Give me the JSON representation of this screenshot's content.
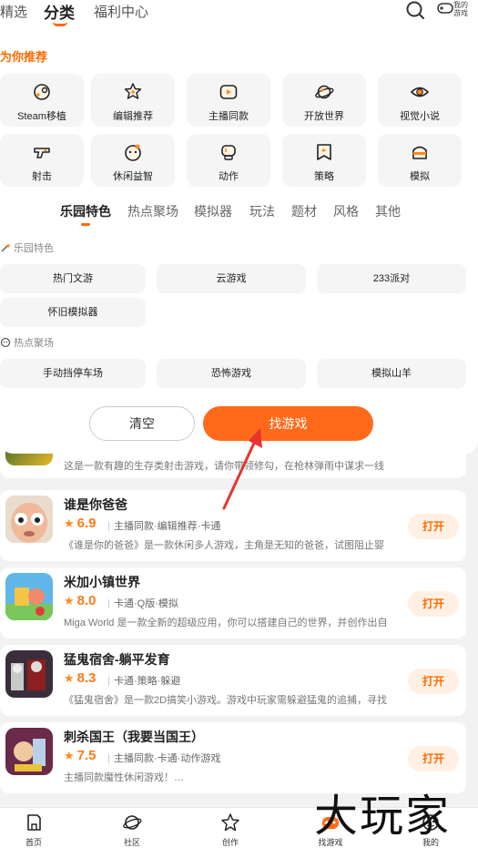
{
  "top_nav": {
    "featured": "精选",
    "category": "分类",
    "welfare": "福利中心",
    "my_games": "我的游戏"
  },
  "recommend": {
    "title": "为你推荐",
    "categories": [
      {
        "label": "Steam移植",
        "icon": "gamepad-icon"
      },
      {
        "label": "编辑推荐",
        "icon": "star-badge-icon"
      },
      {
        "label": "主播同款",
        "icon": "play-video-icon"
      },
      {
        "label": "开放世界",
        "icon": "planet-icon"
      },
      {
        "label": "视觉小说",
        "icon": "eye-icon"
      },
      {
        "label": "射击",
        "icon": "gun-icon"
      },
      {
        "label": "休闲益智",
        "icon": "puzzle-face-icon"
      },
      {
        "label": "动作",
        "icon": "fist-icon"
      },
      {
        "label": "策略",
        "icon": "flag-icon"
      },
      {
        "label": "模拟",
        "icon": "cake-icon"
      }
    ]
  },
  "tabs": [
    "乐园特色",
    "热点聚场",
    "模拟器",
    "玩法",
    "题材",
    "风格",
    "其他"
  ],
  "sections": [
    {
      "title": "乐园特色",
      "chips": [
        "热门文游",
        "云游戏",
        "233派对",
        "怀旧模拟器"
      ]
    },
    {
      "title": "热点聚场",
      "chips": [
        "手动挡停车场",
        "恐怖游戏",
        "模拟山羊"
      ]
    }
  ],
  "actions": {
    "clear": "清空",
    "find": "找游戏"
  },
  "games": [
    {
      "name": "",
      "score": "",
      "tags": "",
      "desc": "这是一款有趣的生存类射击游戏，请你带领修勾，在枪林弹雨中谋求一线",
      "open": ""
    },
    {
      "name": "谁是你爸爸",
      "score": "6.9",
      "tags": "主播同款·编辑推荐·卡通",
      "desc": "《谁是你的爸爸》是一款休闲多人游戏，主角是无知的爸爸，试图阻止婴",
      "open": "打开"
    },
    {
      "name": "米加小镇世界",
      "score": "8.0",
      "tags": "卡通·Q版·模拟",
      "desc": "Miga World 是一款全新的超级应用，你可以搭建自己的世界，并创作出自",
      "open": "打开"
    },
    {
      "name": "猛鬼宿舍-躺平发育",
      "score": "8.3",
      "tags": "卡通·策略·躲避",
      "desc": "《猛鬼宿舍》是一款2D搞笑小游戏。游戏中玩家需躲避猛鬼的追捕，寻找",
      "open": "打开"
    },
    {
      "name": "刺杀国王（我要当国王）",
      "score": "7.5",
      "tags": "主播同款·卡通·动作游戏",
      "desc": "主播同款魔性休闲游戏！…",
      "open": "打开"
    }
  ],
  "bottom_nav": [
    "首页",
    "社区",
    "创作",
    "找游戏",
    "我的"
  ],
  "watermark": "大玩家",
  "colors": {
    "accent": "#ff6a1a",
    "card_bg": "#f5f5f5"
  }
}
